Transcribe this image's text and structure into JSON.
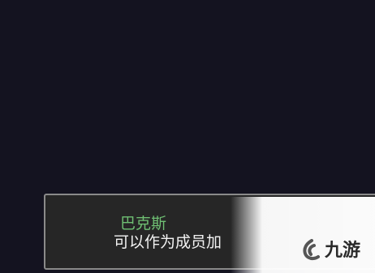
{
  "dialog": {
    "speaker": "巴克斯",
    "text": "可以作为成员加"
  },
  "watermark": {
    "text": "九游",
    "logo_icon": "jiuyou-logo-icon"
  },
  "colors": {
    "background": "#141320",
    "dialog_bg": "#262626",
    "dialog_border": "#8a8a8a",
    "speaker_name": "#6fbf73",
    "dialog_text": "#f2f2f2"
  }
}
